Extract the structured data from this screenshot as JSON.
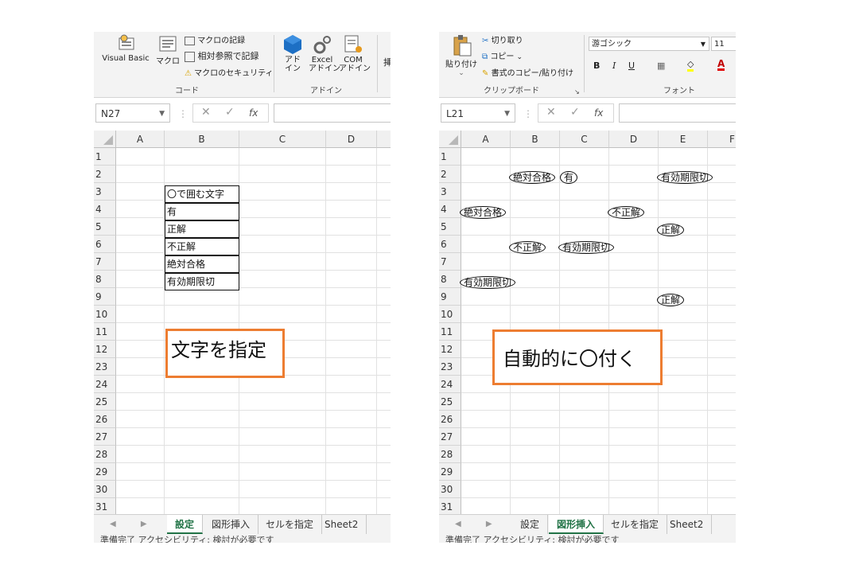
{
  "left": {
    "ribbon": {
      "visual_basic": "Visual Basic",
      "macro": "マクロ",
      "record_macro": "マクロの記録",
      "relative_ref": "相対参照で記録",
      "macro_security": "マクロのセキュリティ",
      "group_code": "コード",
      "addin": "アド\nイン",
      "excel_addin": "Excel\nアドイン",
      "com_addin": "COM\nアドイン",
      "group_addin": "アドイン",
      "cut_glyph": "挿"
    },
    "name_box": "N27",
    "columns": [
      "A",
      "B",
      "C",
      "D"
    ],
    "rows": [
      "1",
      "2",
      "3",
      "4",
      "5",
      "6",
      "7",
      "8",
      "9",
      "10",
      "11",
      "12",
      "23",
      "24",
      "25",
      "26",
      "27",
      "28",
      "29",
      "30",
      "31"
    ],
    "table": [
      "〇で囲む文字",
      "有",
      "正解",
      "不正解",
      "絶対合格",
      "有効期限切"
    ],
    "callout": "文字を指定",
    "tabs": [
      "設定",
      "図形挿入",
      "セルを指定",
      "Sheet2"
    ],
    "active_tab": "設定",
    "status": "準備完了    アクセシビリティ: 検討が必要です"
  },
  "right": {
    "ribbon": {
      "cut": "切り取り",
      "copy": "コピー",
      "paste": "貼り付け",
      "format_painter": "書式のコピー/貼り付け",
      "group_clipboard": "クリップボード",
      "font_name": "游ゴシック",
      "font_size": "11",
      "bold": "B",
      "italic": "I",
      "underline": "U",
      "font_color": "A",
      "group_font": "フォント"
    },
    "name_box": "L21",
    "columns": [
      "A",
      "B",
      "C",
      "D",
      "E",
      "F"
    ],
    "rows": [
      "1",
      "2",
      "3",
      "4",
      "5",
      "6",
      "7",
      "8",
      "9",
      "10",
      "11",
      "12",
      "23",
      "24",
      "25",
      "26",
      "27",
      "28",
      "29",
      "30",
      "31"
    ],
    "circled": [
      {
        "text": "絶対合格"
      },
      {
        "text": "有"
      },
      {
        "text": "有効期限切"
      },
      {
        "text": "絶対合格"
      },
      {
        "text": "不正解"
      },
      {
        "text": "正解"
      },
      {
        "text": "不正解"
      },
      {
        "text": "有効期限切"
      },
      {
        "text": "有効期限切"
      },
      {
        "text": "正解"
      }
    ],
    "callout": "自動的に〇付く",
    "tabs": [
      "設定",
      "図形挿入",
      "セルを指定",
      "Sheet2"
    ],
    "active_tab": "図形挿入",
    "status": "準備完了    アクセシビリティ: 検討が必要です"
  },
  "colors": {
    "accent_orange": "#ed7d31",
    "excel_green": "#217346"
  }
}
